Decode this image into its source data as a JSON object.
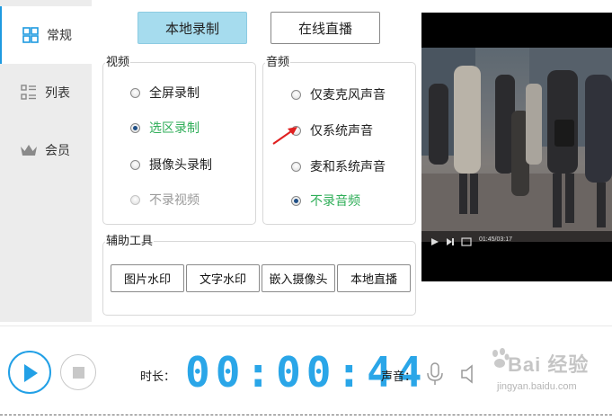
{
  "sidebar": {
    "items": [
      {
        "label": "常规",
        "icon": "grid-icon",
        "active": true
      },
      {
        "label": "列表",
        "icon": "list-icon",
        "active": false
      },
      {
        "label": "会员",
        "icon": "crown-icon",
        "active": false
      }
    ]
  },
  "mode_tabs": {
    "local_label": "本地录制",
    "live_label": "在线直播"
  },
  "video_group": {
    "title": "视频",
    "options": [
      {
        "label": "全屏录制",
        "checked": false,
        "disabled": false
      },
      {
        "label": "选区录制",
        "checked": true,
        "disabled": false
      },
      {
        "label": "摄像头录制",
        "checked": false,
        "disabled": false
      },
      {
        "label": "不录视频",
        "checked": false,
        "disabled": true
      }
    ]
  },
  "audio_group": {
    "title": "音频",
    "options": [
      {
        "label": "仅麦克风声音",
        "checked": false
      },
      {
        "label": "仅系统声音",
        "checked": false
      },
      {
        "label": "麦和系统声音",
        "checked": false
      },
      {
        "label": "不录音频",
        "checked": true
      }
    ]
  },
  "tools": {
    "title": "辅助工具",
    "buttons": [
      "图片水印",
      "文字水印",
      "嵌入摄像头",
      "本地直播"
    ]
  },
  "preview": {
    "time_text": "01:45/03:17"
  },
  "bottom": {
    "duration_label": "时长：",
    "timer": "00:00:44",
    "volume_label": "声音："
  },
  "watermark": {
    "top": "Bai 经验",
    "bottom": "jingyan.baidu.com"
  },
  "colors": {
    "accent": "#1e9ae0",
    "selected_green": "#2fae58",
    "tab_active_bg": "#a6dcee",
    "arrow": "#e02020"
  }
}
